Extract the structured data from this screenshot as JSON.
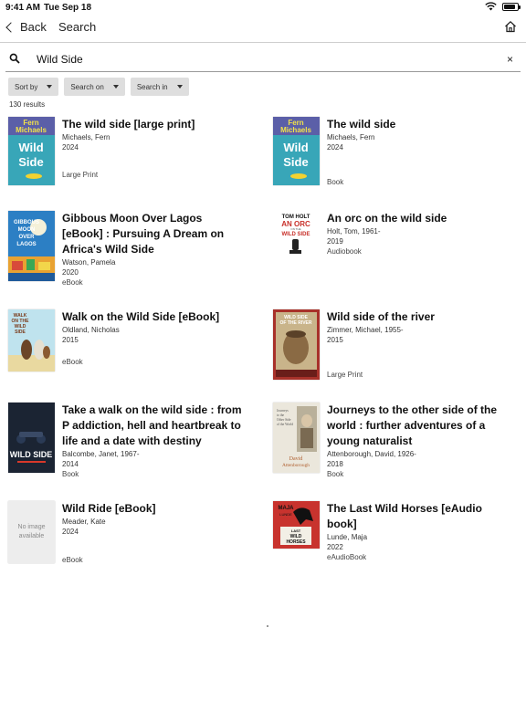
{
  "status": {
    "time": "9:41 AM",
    "date": "Tue Sep 18"
  },
  "nav": {
    "back_label": "Back",
    "title": "Search"
  },
  "search": {
    "value": "Wild Side",
    "placeholder": "Search",
    "clear": "×"
  },
  "filters": [
    {
      "label": "Sort by"
    },
    {
      "label": "Search on"
    },
    {
      "label": "Search in"
    }
  ],
  "results_count": "130 results",
  "results": [
    {
      "title": "The wild side [large print]",
      "author": "Michaels, Fern",
      "year": "2024",
      "format": "Large Print",
      "cover": {
        "top": "Fern",
        "mid": "Michaels",
        "big": "Wild Side",
        "bg": "#3aa8b8"
      }
    },
    {
      "title": "The wild side",
      "author": "Michaels, Fern",
      "year": "2024",
      "format": "Book",
      "cover": {
        "top": "Fern",
        "mid": "Michaels",
        "big": "Wild Side",
        "bg": "#3aa8b8"
      }
    },
    {
      "title": "Gibbous Moon Over Lagos [eBook] : Pursuing A Dream on Africa's Wild Side",
      "author": "Watson, Pamela",
      "year": "2020",
      "format": "eBook",
      "cover": {
        "top": "GIBBOUS MOON OVER LAGOS",
        "mid": "",
        "big": "",
        "bg": "#2b7cc0"
      }
    },
    {
      "title": "An orc on the wild side",
      "author": "Holt, Tom, 1961-",
      "year": "2019",
      "format": "Audiobook",
      "cover": {
        "top": "TOM HOLT",
        "mid": "AN ORC",
        "big": "WILD SIDE",
        "bg": "#ffffff"
      }
    },
    {
      "title": "Walk on the Wild Side [eBook]",
      "author": "Oldland, Nicholas",
      "year": "2015",
      "format": "eBook",
      "cover": {
        "top": "WALK ON THE WILD SIDE",
        "mid": "",
        "big": "",
        "bg": "#bfe3ef"
      }
    },
    {
      "title": "Wild side of the river",
      "author": "Zimmer, Michael, 1955-",
      "year": "2015",
      "format": "Large Print",
      "cover": {
        "top": "WILD SIDE OF THE RIVER",
        "mid": "",
        "big": "",
        "bg": "#a8322a"
      }
    },
    {
      "title": "Take a walk on the wild side : from P addiction, hell and heartbreak to life and a date with destiny",
      "author": "Balcombe, Janet, 1967-",
      "year": "2014",
      "format": "Book",
      "cover": {
        "top": "",
        "mid": "",
        "big": "WILD SIDE",
        "bg": "#1f2a3a"
      }
    },
    {
      "title": "Journeys to the other side of the world : further adventures of a young naturalist",
      "author": "Attenborough, David, 1926-",
      "year": "2018",
      "format": "Book",
      "cover": {
        "top": "Journeys to the Other Side of the World",
        "mid": "",
        "big": "David Attenborough",
        "bg": "#e8e4da"
      }
    },
    {
      "title": "Wild Ride [eBook]",
      "author": "Meader, Kate",
      "year": "2024",
      "format": "eBook",
      "cover": {
        "top": "No image available",
        "mid": "",
        "big": "",
        "bg": "#ededed"
      }
    },
    {
      "title": "The Last Wild Horses [eAudio book]",
      "author": "Lunde, Maja",
      "year": "2022",
      "format": "eAudioBook",
      "cover": {
        "top": "MAJA",
        "mid": "LUNDE",
        "big": "LAST WILD HORSES",
        "bg": "#c9332e"
      }
    }
  ],
  "colors": {
    "filter_bg": "#dedede",
    "divider": "#cfcfcf",
    "text": "#111111"
  }
}
